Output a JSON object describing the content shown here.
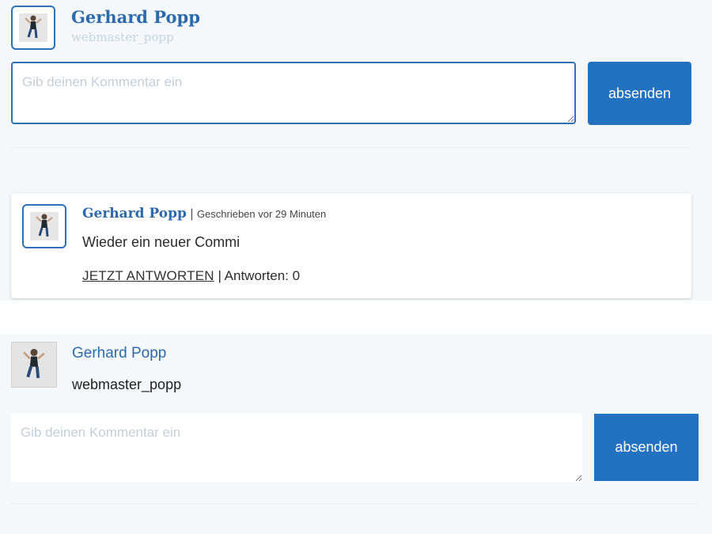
{
  "top_form": {
    "author_name": "Gerhard Popp",
    "username": "webmaster_popp",
    "comment_placeholder": "Gib deinen Kommentar ein",
    "submit_label": "absenden"
  },
  "comment": {
    "author_name": "Gerhard Popp",
    "separator": "|",
    "posted_text": "Geschrieben vor 29 Minuten",
    "body": "Wieder ein neuer Commi",
    "reply_label": "JETZT ANTWORTEN",
    "replies_text": "| Antworten: 0"
  },
  "bottom_form": {
    "author_name": "Gerhard Popp",
    "username": "webmaster_popp",
    "comment_placeholder": "Gib deinen Kommentar ein",
    "submit_label": "absenden"
  },
  "colors": {
    "accent": "#2272bf",
    "name_blue": "#2c6aab",
    "page_bg": "#f5f8fb"
  }
}
